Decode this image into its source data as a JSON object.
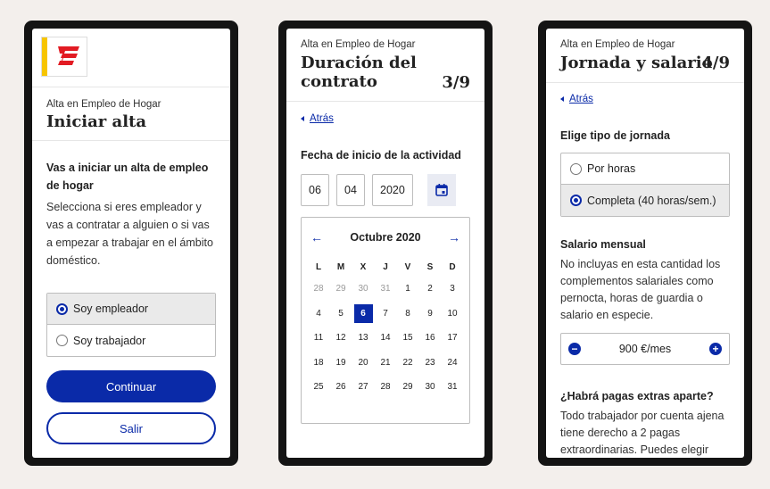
{
  "phone1": {
    "logo": "logo-icon",
    "subtitle": "Alta en Empleo de Hogar",
    "title": "Iniciar alta",
    "intro_bold": "Vas a iniciar un alta de empleo de hogar",
    "intro_text": "Selecciona si eres empleador y vas a contratar a alguien o si vas a empezar a trabajar en el ámbito doméstico.",
    "options": [
      {
        "label": "Soy empleador",
        "selected": true
      },
      {
        "label": "Soy trabajador",
        "selected": false
      }
    ],
    "continue_label": "Continuar",
    "exit_label": "Salir"
  },
  "phone2": {
    "subtitle": "Alta en Empleo de Hogar",
    "title_line1": "Duración del",
    "title_line2": "contrato",
    "step": "3/9",
    "back_label": "Atrás",
    "date_label": "Fecha de inicio de la actividad",
    "day": "06",
    "month": "04",
    "year": "2020",
    "calendar": {
      "month_label": "Octubre 2020",
      "prev": "←",
      "next": "→",
      "weekdays": [
        "L",
        "M",
        "X",
        "J",
        "V",
        "S",
        "D"
      ],
      "weeks": [
        [
          "28",
          "29",
          "30",
          "31",
          "1",
          "2",
          "3"
        ],
        [
          "4",
          "5",
          "6",
          "7",
          "8",
          "9",
          "10"
        ],
        [
          "11",
          "12",
          "13",
          "14",
          "15",
          "16",
          "17"
        ],
        [
          "18",
          "19",
          "20",
          "21",
          "22",
          "23",
          "24"
        ],
        [
          "25",
          "26",
          "27",
          "28",
          "29",
          "30",
          "31"
        ]
      ],
      "selected_day": "6"
    }
  },
  "phone3": {
    "subtitle": "Alta en Empleo de Hogar",
    "title": "Jornada y salario",
    "step": "4/9",
    "back_label": "Atrás",
    "jornada_label": "Elige tipo de jornada",
    "jornada_options": [
      {
        "label": "Por horas",
        "selected": false
      },
      {
        "label": "Completa (40 horas/sem.)",
        "selected": true
      }
    ],
    "salario_label": "Salario mensual",
    "salario_text": "No incluyas en esta cantidad los complementos salariales como pernocta, horas de guardia o salario en especie.",
    "salario_value": "900 €/mes",
    "minus": "−",
    "plus": "+",
    "pagas_label": "¿Habrá pagas extras aparte?",
    "pagas_text": "Todo trabajador por cuenta ajena tiene derecho a 2 pagas extraordinarias. Puedes elegir"
  },
  "colors": {
    "accent": "#0a2aa8",
    "brand_red": "#e21b23",
    "brand_yellow": "#f7c500"
  }
}
